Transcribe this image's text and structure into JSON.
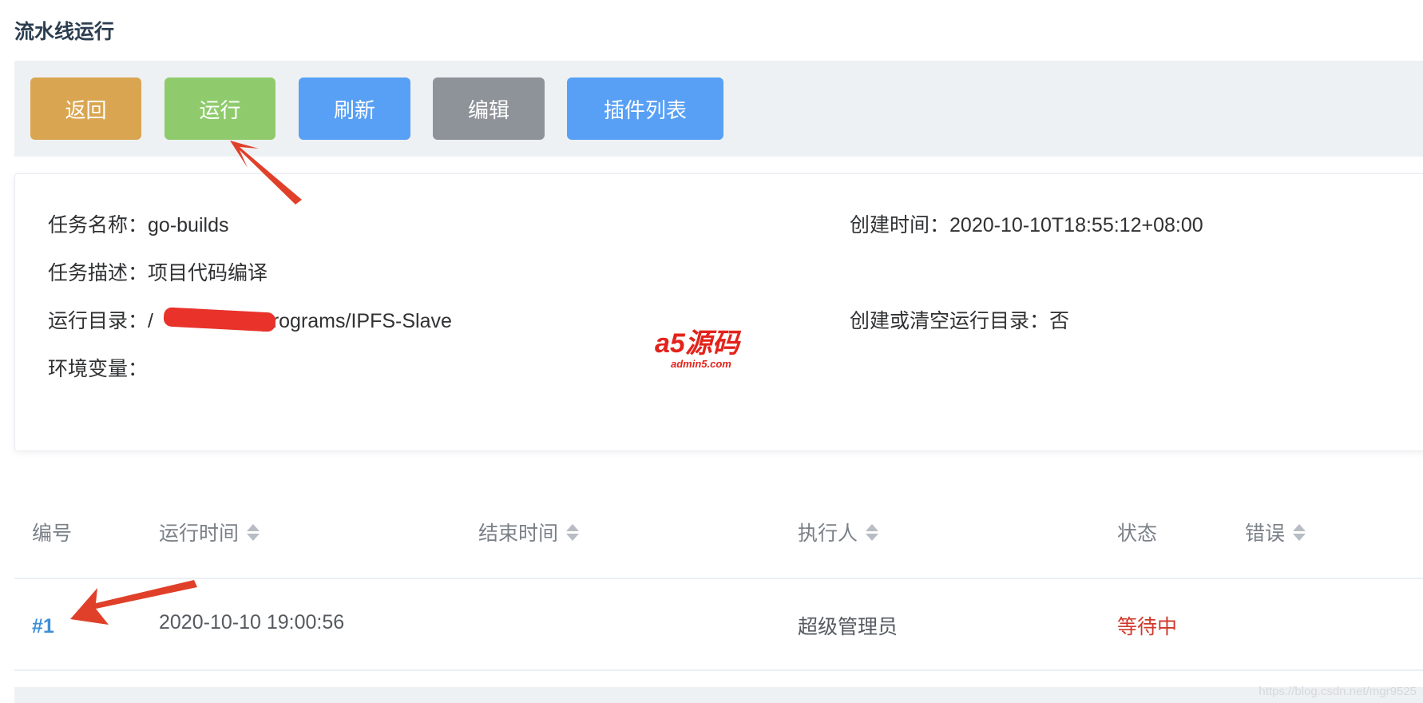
{
  "page_title": "流水线运行",
  "toolbar": {
    "back": "返回",
    "run": "运行",
    "refresh": "刷新",
    "edit": "编辑",
    "plugins": "插件列表",
    "colors": {
      "back": "#d9a550",
      "run": "#8fcb6d",
      "refresh": "#58a0f5",
      "edit": "#8e9399",
      "plugins": "#58a0f5"
    }
  },
  "info": {
    "task_name_label": "任务名称：",
    "task_name": "go-builds",
    "task_desc_label": "任务描述：",
    "task_desc": "项目代码编译",
    "run_dir_label": "运行目录：",
    "run_dir_prefix": "/",
    "run_dir_visible": "/programs/IPFS-Slave",
    "env_label": "环境变量：",
    "created_label": "创建时间：",
    "created": "2020-10-10T18:55:12+08:00",
    "clear_dir_label": "创建或清空运行目录：",
    "clear_dir": "否"
  },
  "table": {
    "headers": [
      "编号",
      "运行时间",
      "结束时间",
      "执行人",
      "状态",
      "错误"
    ],
    "rows": [
      {
        "id": "#1",
        "start": "2020-10-10 19:00:56",
        "end": "",
        "executor": "超级管理员",
        "status": "等待中",
        "error": ""
      }
    ]
  },
  "overlay": {
    "logo_text": "a5源码",
    "logo_sub": "admin5.com",
    "watermark": "https://blog.csdn.net/mgr9525"
  }
}
